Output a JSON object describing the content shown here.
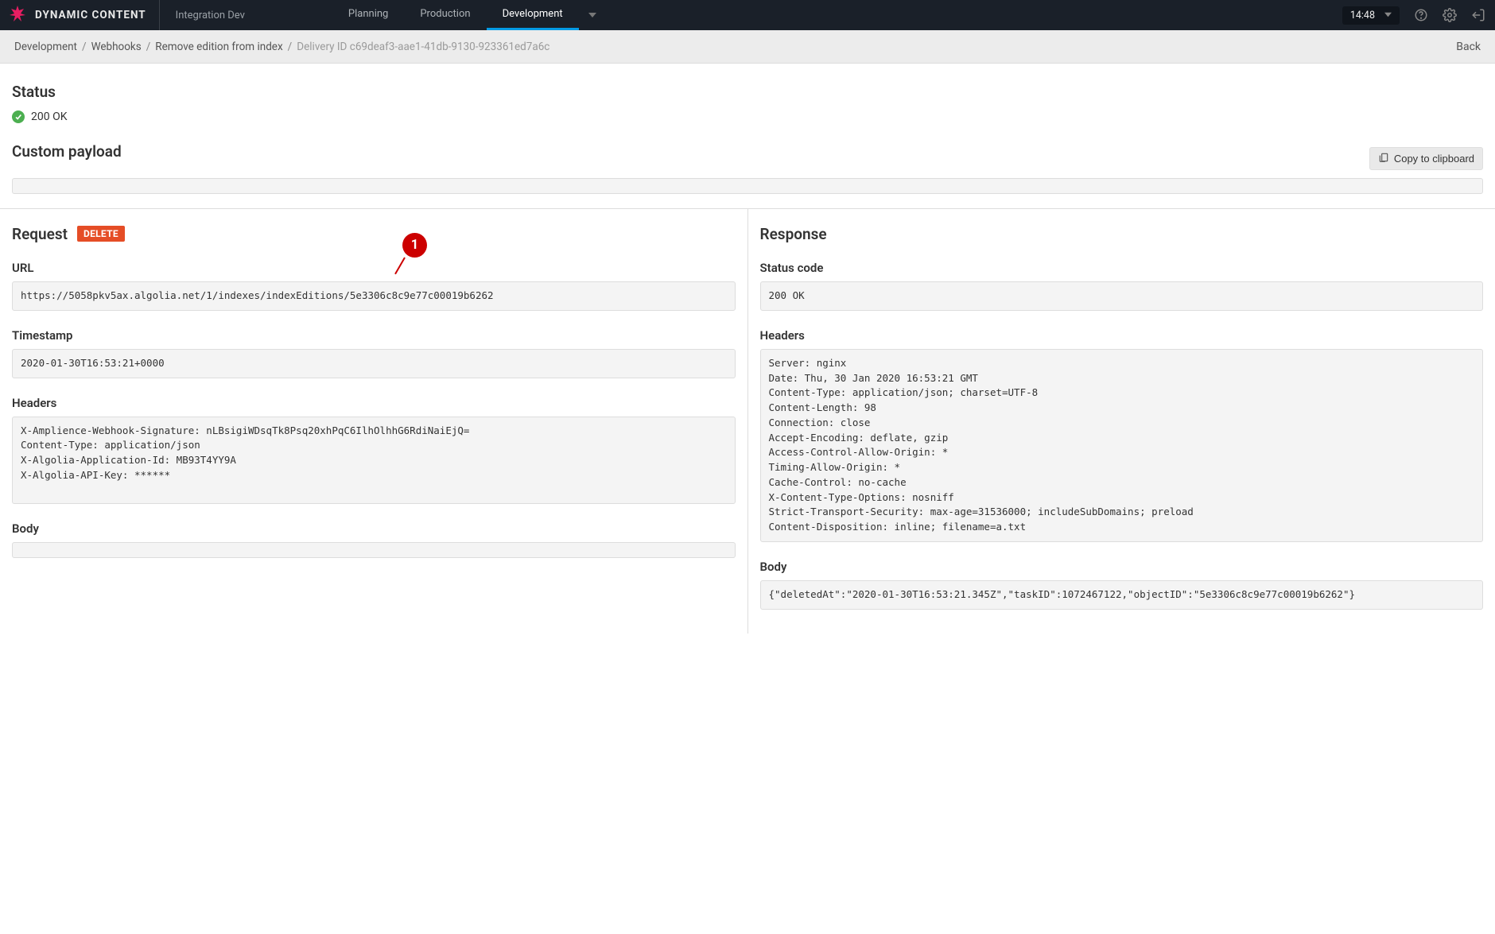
{
  "header": {
    "brand": "DYNAMIC CONTENT",
    "context": "Integration Dev",
    "tabs": [
      "Planning",
      "Production",
      "Development"
    ],
    "active_tab": 2,
    "time": "14:48"
  },
  "breadcrumb": {
    "items": [
      "Development",
      "Webhooks",
      "Remove edition from index"
    ],
    "delivery_id_label": "Delivery ID c69deaf3-aae1-41db-9130-923361ed7a6c",
    "back_label": "Back"
  },
  "status": {
    "section_title": "Status",
    "text": "200 OK"
  },
  "payload": {
    "section_title": "Custom payload",
    "copy_label": "Copy to clipboard",
    "body": ""
  },
  "request": {
    "title": "Request",
    "method": "DELETE",
    "url_label": "URL",
    "url": "https://5058pkv5ax.algolia.net/1/indexes/indexEditions/5e3306c8c9e77c00019b6262",
    "timestamp_label": "Timestamp",
    "timestamp": "2020-01-30T16:53:21+0000",
    "headers_label": "Headers",
    "headers": "X-Amplience-Webhook-Signature: nLBsigiWDsqTk8Psq20xhPqC6IlhOlhhG6RdiNaiEjQ=\nContent-Type: application/json\nX-Algolia-Application-Id: MB93T4YY9A\nX-Algolia-API-Key: ******",
    "body_label": "Body",
    "body": ""
  },
  "response": {
    "title": "Response",
    "status_code_label": "Status code",
    "status_code": "200 OK",
    "headers_label": "Headers",
    "headers": "Server: nginx\nDate: Thu, 30 Jan 2020 16:53:21 GMT\nContent-Type: application/json; charset=UTF-8\nContent-Length: 98\nConnection: close\nAccept-Encoding: deflate, gzip\nAccess-Control-Allow-Origin: *\nTiming-Allow-Origin: *\nCache-Control: no-cache\nX-Content-Type-Options: nosniff\nStrict-Transport-Security: max-age=31536000; includeSubDomains; preload\nContent-Disposition: inline; filename=a.txt",
    "body_label": "Body",
    "body": "{\"deletedAt\":\"2020-01-30T16:53:21.345Z\",\"taskID\":1072467122,\"objectID\":\"5e3306c8c9e77c00019b6262\"}"
  },
  "annotation": {
    "label": "1"
  }
}
